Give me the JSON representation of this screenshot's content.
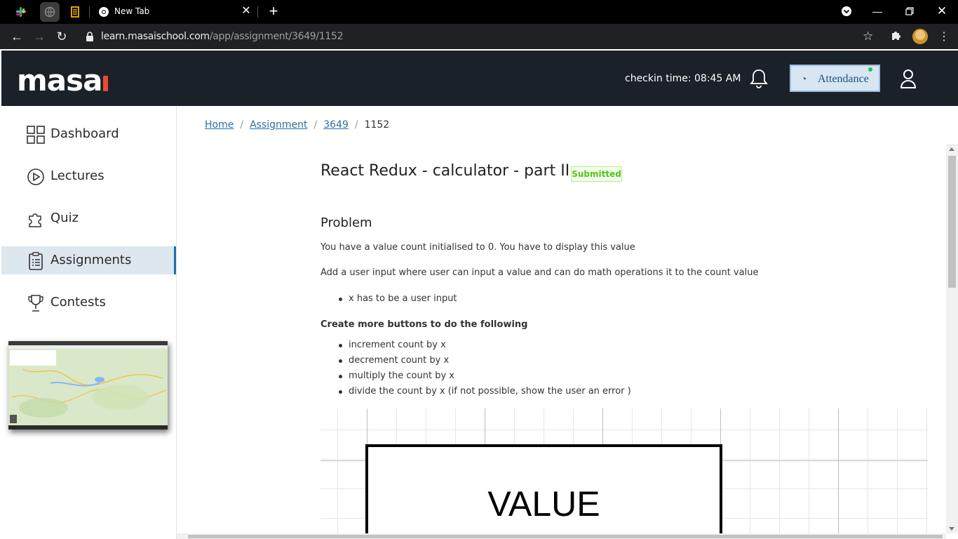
{
  "browser": {
    "tab_title": "New Tab",
    "url_host": "learn.masaischool.com",
    "url_path": "/app/assignment/3649/1152"
  },
  "header": {
    "logo_text": "masa",
    "checkin": "checkin time: 08:45 AM",
    "attendance_label": "Attendance"
  },
  "sidebar": {
    "items": [
      {
        "label": "Dashboard",
        "icon": "grid-icon"
      },
      {
        "label": "Lectures",
        "icon": "play-circle-icon"
      },
      {
        "label": "Quiz",
        "icon": "puzzle-icon"
      },
      {
        "label": "Assignments",
        "icon": "clipboard-icon",
        "active": true
      },
      {
        "label": "Contests",
        "icon": "trophy-icon"
      }
    ]
  },
  "breadcrumb": {
    "home": "Home",
    "assignment": "Assignment",
    "id": "3649",
    "current": "1152"
  },
  "assignment": {
    "title": "React Redux - calculator - part II",
    "status": "Submitted",
    "problem_heading": "Problem",
    "p1": "You have a value count initialised to 0. You have to display this value",
    "p2": "Add a user input where user can input a value and can do math operations it to the count value",
    "bullets1": [
      "x has to be a user input"
    ],
    "subheading": "Create more buttons to do the following",
    "bullets2": [
      "increment count by x",
      "decrement count by x",
      "multiply the count by x",
      "divide the count by x (if not possible, show the user an error )"
    ],
    "diagram_value": "VALUE"
  },
  "colors": {
    "header_bg": "#1b2129",
    "accent": "#1f6fa9",
    "badge_green": "#52c41a"
  }
}
